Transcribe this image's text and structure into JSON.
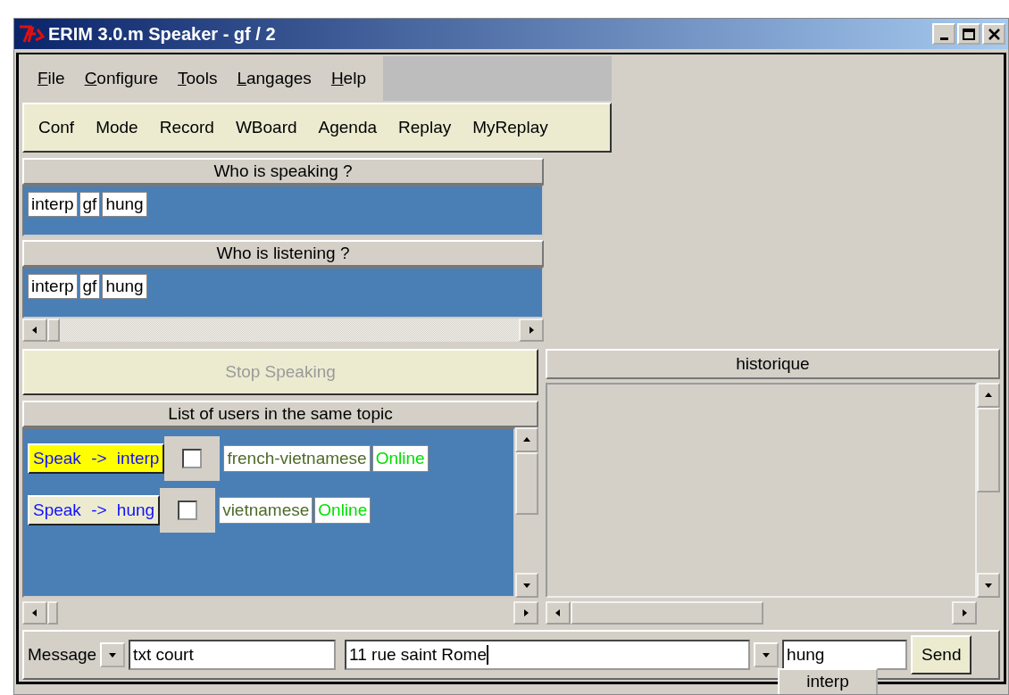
{
  "window": {
    "title": "ERIM 3.0.m Speaker - gf / 2"
  },
  "menu": [
    {
      "label": "File"
    },
    {
      "label": "Configure"
    },
    {
      "label": "Tools"
    },
    {
      "label": "Langages"
    },
    {
      "label": "Help"
    }
  ],
  "toolbar": [
    "Conf",
    "Mode",
    "Record",
    "WBoard",
    "Agenda",
    "Replay",
    "MyReplay"
  ],
  "speaking": {
    "title": "Who is speaking ?",
    "users": [
      "interp",
      "gf",
      "hung"
    ]
  },
  "listening": {
    "title": "Who is listening ?",
    "users": [
      "interp",
      "gf",
      "hung"
    ]
  },
  "stop_button": {
    "label": "Stop Speaking",
    "disabled": true
  },
  "users_list": {
    "title": "List of users in the same topic",
    "rows": [
      {
        "speak": "Speak -> interp",
        "selected": true,
        "checked": false,
        "language": "french-vietnamese",
        "status": "Online"
      },
      {
        "speak": "Speak -> hung",
        "selected": false,
        "checked": false,
        "language": "vietnamese",
        "status": "Online"
      }
    ]
  },
  "history": {
    "title": "historique"
  },
  "message_bar": {
    "label": "Message",
    "type_value": "txt court",
    "text_value": "11 rue saint Rome",
    "recipient_value": "hung",
    "send": "Send"
  },
  "dropdown_popup": {
    "items": [
      "interp"
    ]
  }
}
